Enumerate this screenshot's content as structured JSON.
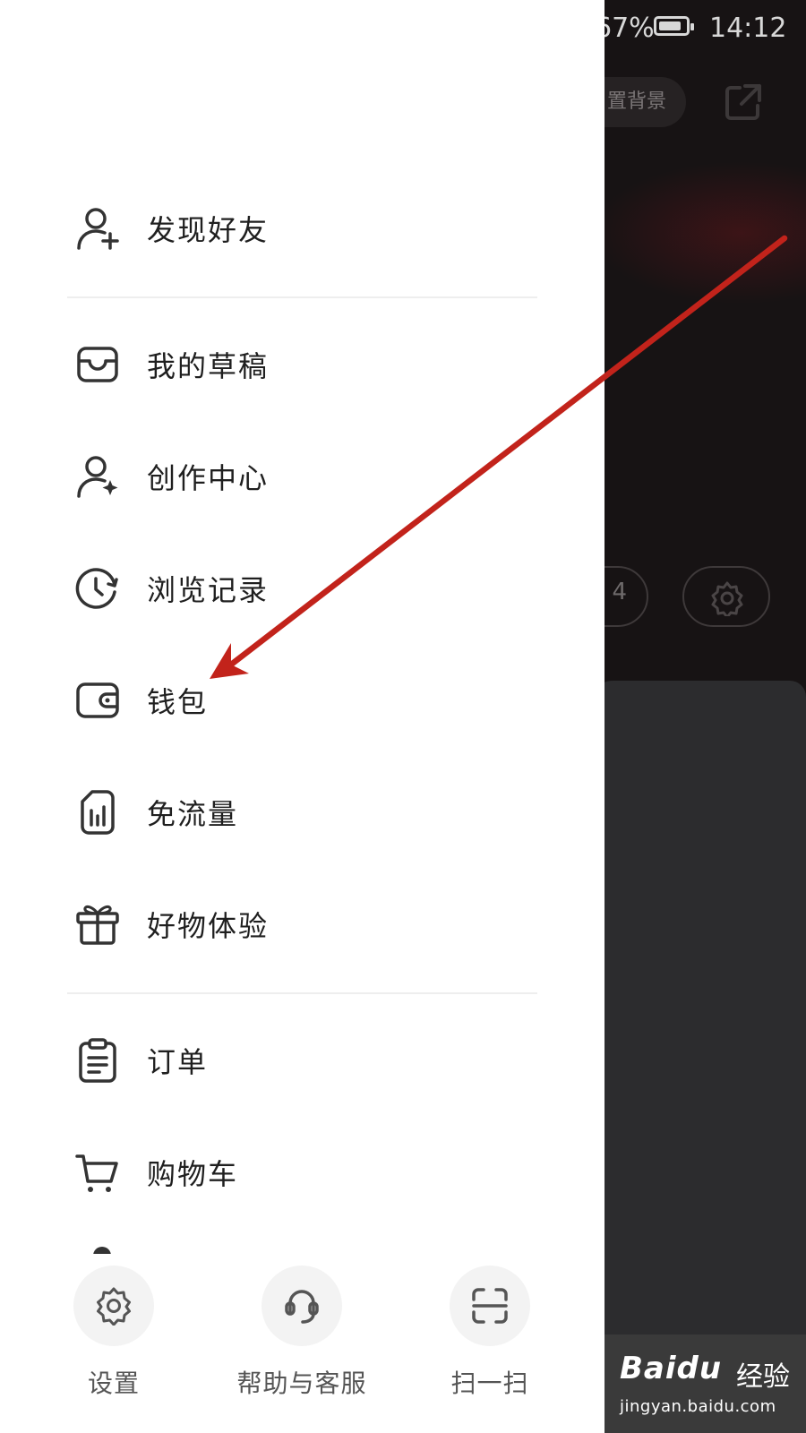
{
  "status_bar": {
    "battery_percent": "67%",
    "time": "14:12"
  },
  "background": {
    "chip_label": "置背景",
    "button_fragment": "4"
  },
  "menu": {
    "items": [
      {
        "label": "发现好友",
        "icon": "add-friend-icon"
      },
      {
        "label": "我的草稿",
        "icon": "inbox-icon"
      },
      {
        "label": "创作中心",
        "icon": "creator-icon"
      },
      {
        "label": "浏览记录",
        "icon": "history-icon"
      },
      {
        "label": "钱包",
        "icon": "wallet-icon"
      },
      {
        "label": "免流量",
        "icon": "sim-card-icon"
      },
      {
        "label": "好物体验",
        "icon": "gift-icon"
      },
      {
        "label": "订单",
        "icon": "clipboard-icon"
      },
      {
        "label": "购物车",
        "icon": "cart-icon"
      }
    ]
  },
  "bottom_bar": {
    "settings_label": "设置",
    "help_label": "帮助与客服",
    "scan_label": "扫一扫"
  },
  "watermark": {
    "brand": "Baidu",
    "brand_suffix": "经验",
    "url": "jingyan.baidu.com"
  },
  "colors": {
    "arrow": "#c2231b",
    "drawer_bg": "#ffffff",
    "overlay_bg": "#171314",
    "icon_stroke": "#333333"
  }
}
